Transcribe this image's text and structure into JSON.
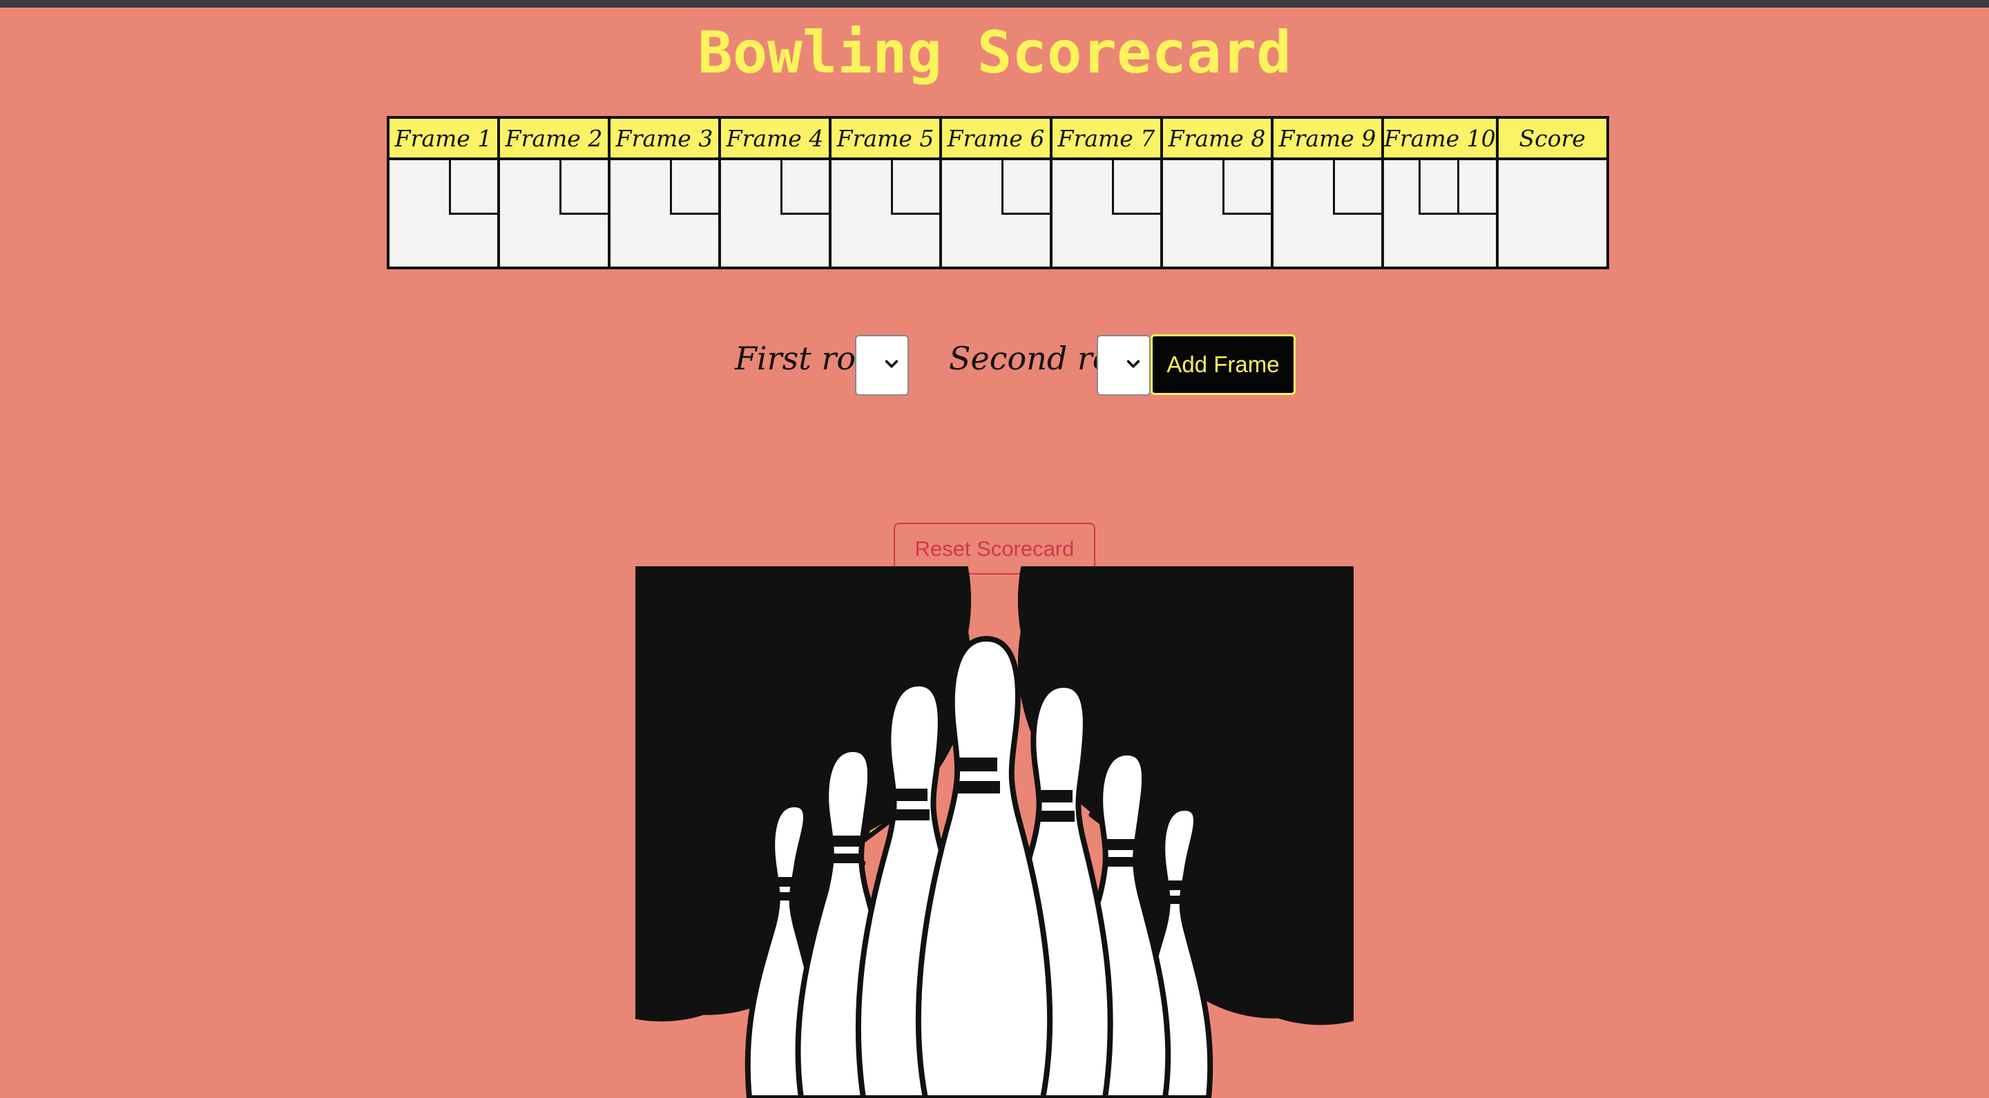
{
  "app": {
    "title": "Bowling Scorecard"
  },
  "scorecard": {
    "headers": [
      "Frame 1",
      "Frame 2",
      "Frame 3",
      "Frame 4",
      "Frame 5",
      "Frame 6",
      "Frame 7",
      "Frame 8",
      "Frame 9",
      "Frame 10",
      "Score"
    ],
    "header_color": "#fbf365",
    "cell_color": "#f4f4f4"
  },
  "controls": {
    "first_roll_label": "First roll",
    "first_roll_value": "",
    "second_roll_label": "Second roll",
    "second_roll_value": "",
    "add_frame_label": "Add Frame",
    "reset_label": "Reset Scorecard"
  },
  "icons": {
    "illustration": "bowling-pins-with-stars-illustration",
    "select_arrow": "chevron-down-icon"
  },
  "colors": {
    "background": "#ea8676",
    "title": "#fdf35b",
    "reset": "#d0384e"
  }
}
